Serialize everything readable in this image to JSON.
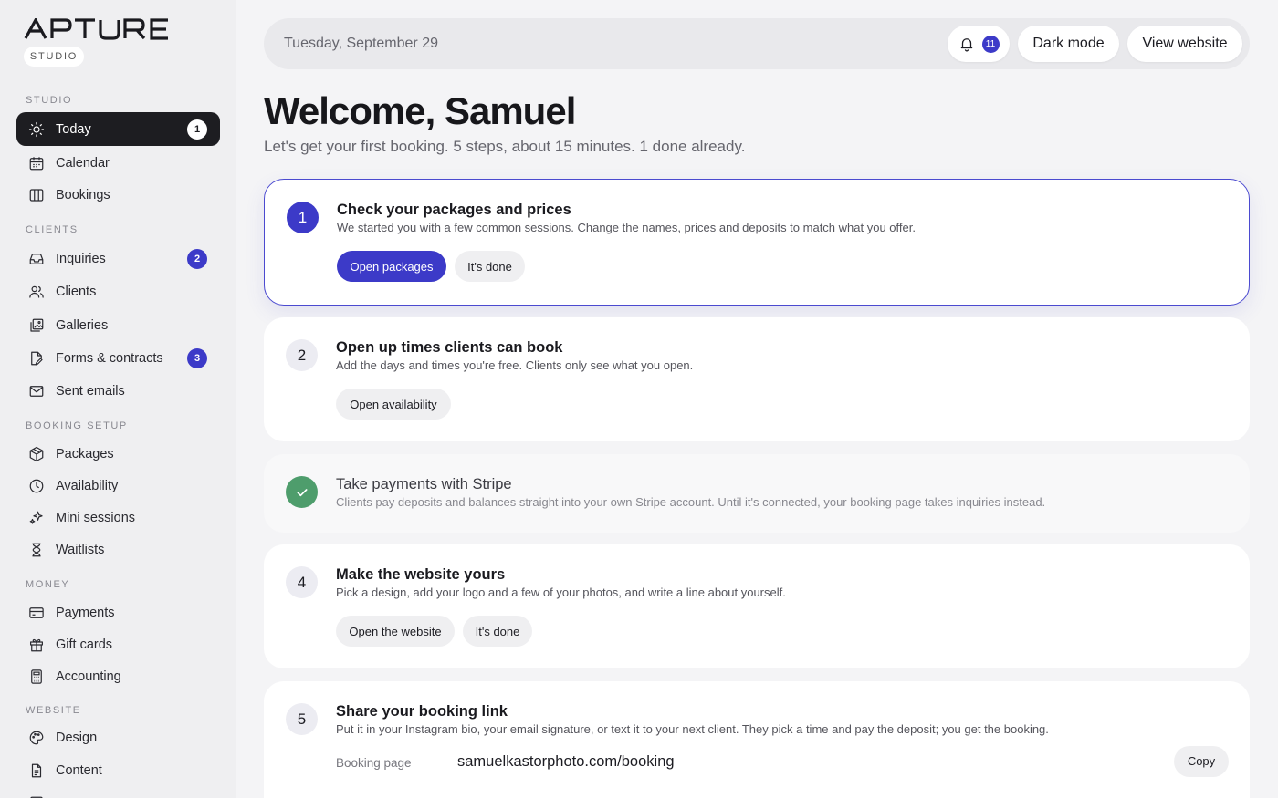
{
  "brand": {
    "name": "APTURE",
    "tag": "STUDIO"
  },
  "sidebar": {
    "sections": [
      {
        "label": "STUDIO"
      },
      {
        "label": "CLIENTS"
      },
      {
        "label": "BOOKING SETUP"
      },
      {
        "label": "MONEY"
      },
      {
        "label": "WEBSITE"
      }
    ],
    "items": [
      {
        "label": "Today",
        "icon": "sun-icon",
        "badge": "1",
        "active": true
      },
      {
        "label": "Calendar",
        "icon": "calendar-icon"
      },
      {
        "label": "Bookings",
        "icon": "columns-icon"
      },
      {
        "label": "Inquiries",
        "icon": "inbox-icon",
        "badge": "2"
      },
      {
        "label": "Clients",
        "icon": "users-icon"
      },
      {
        "label": "Galleries",
        "icon": "images-icon"
      },
      {
        "label": "Forms & contracts",
        "icon": "file-edit-icon",
        "badge": "3"
      },
      {
        "label": "Sent emails",
        "icon": "mail-icon"
      },
      {
        "label": "Packages",
        "icon": "package-icon"
      },
      {
        "label": "Availability",
        "icon": "clock-icon"
      },
      {
        "label": "Mini sessions",
        "icon": "sparkles-icon"
      },
      {
        "label": "Waitlists",
        "icon": "hourglass-icon"
      },
      {
        "label": "Payments",
        "icon": "credit-card-icon"
      },
      {
        "label": "Gift cards",
        "icon": "gift-icon"
      },
      {
        "label": "Accounting",
        "icon": "calculator-icon"
      },
      {
        "label": "Design",
        "icon": "palette-icon"
      },
      {
        "label": "Content",
        "icon": "document-icon"
      }
    ]
  },
  "topbar": {
    "date": "Tuesday, September 29",
    "notifications": "11",
    "dark_mode": "Dark mode",
    "view_website": "View website"
  },
  "header": {
    "title": "Welcome, Samuel",
    "subtitle": "Let's get your first booking. 5 steps, about 15 minutes. 1 done already."
  },
  "steps": [
    {
      "number": "1",
      "title": "Check your packages and prices",
      "desc": "We started you with a few common sessions. Change the names, prices and deposits to match what you offer.",
      "primary": "Open packages",
      "secondary": "It's done"
    },
    {
      "number": "2",
      "title": "Open up times clients can book",
      "desc": "Add the days and times you're free. Clients only see what you open.",
      "secondary": "Open availability"
    },
    {
      "title": "Take payments with Stripe",
      "desc": "Clients pay deposits and balances straight into your own Stripe account. Until it's connected, your booking page takes inquiries instead."
    },
    {
      "number": "4",
      "title": "Make the website yours",
      "desc": "Pick a design, add your logo and a few of your photos, and write a line about yourself.",
      "primary": "Open the website",
      "secondary": "It's done"
    },
    {
      "number": "5",
      "title": "Share your booking link",
      "desc": "Put it in your Instagram bio, your email signature, or text it to your next client. They pick a time and pay the deposit; you get the booking.",
      "field_label": "Booking page",
      "field_value": "samuelkastorphoto.com/booking",
      "copy": "Copy"
    }
  ],
  "colors": {
    "accent": "#3c3ac8",
    "done": "#4e9d6c",
    "active_nav": "#1d1d21"
  }
}
